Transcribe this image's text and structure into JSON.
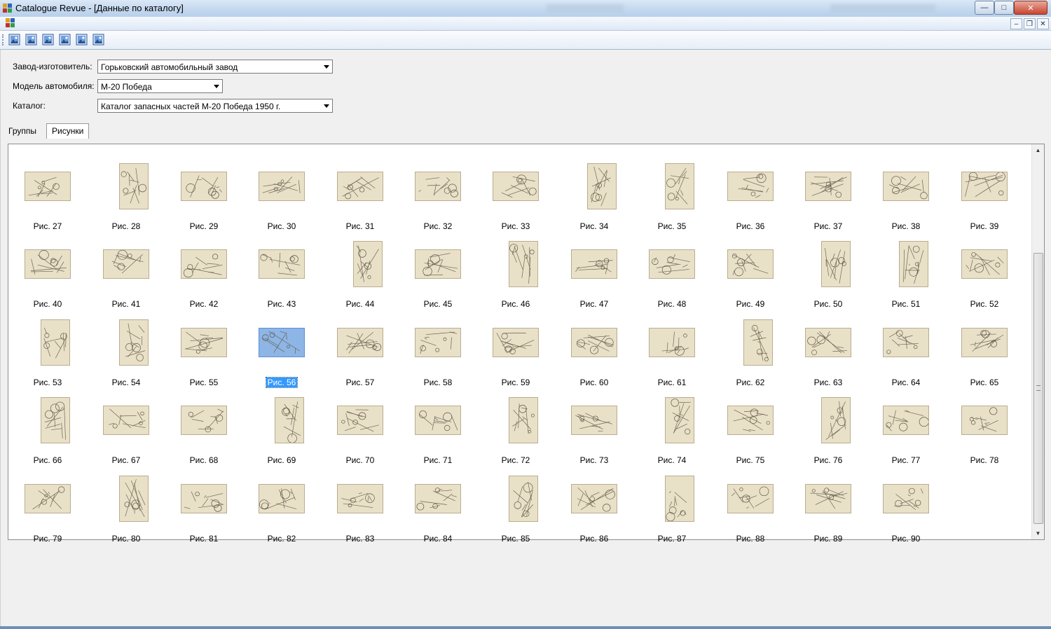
{
  "window": {
    "title": "Catalogue Revue - [Данные по каталогу]",
    "controls": {
      "minimize": "—",
      "maximize": "□",
      "close": "✕"
    },
    "mdi_controls": {
      "minimize": "–",
      "restore": "❐",
      "close": "✕"
    }
  },
  "toolbar": {
    "buttons": [
      "image-icon",
      "image-icon",
      "image-icon",
      "image-icon",
      "image-icon",
      "image-icon"
    ]
  },
  "form": {
    "manufacturer_label": "Завод-изготовитель:",
    "manufacturer_value": "Горьковский автомобильный завод",
    "model_label": "Модель автомобиля:",
    "model_value": "М-20 Победа",
    "catalog_label": "Каталог:",
    "catalog_value": "Каталог запасных частей М-20 Победа 1950 г."
  },
  "tabs": [
    {
      "label": "Группы",
      "active": false
    },
    {
      "label": "Рисунки",
      "active": true
    }
  ],
  "gallery": {
    "selected": "Рис. 56",
    "items": [
      "Рис. 27",
      "Рис. 28",
      "Рис. 29",
      "Рис. 30",
      "Рис. 31",
      "Рис. 32",
      "Рис. 33",
      "Рис. 34",
      "Рис. 35",
      "Рис. 36",
      "Рис. 37",
      "Рис. 38",
      "Рис. 39",
      "Рис. 40",
      "Рис. 41",
      "Рис. 42",
      "Рис. 43",
      "Рис. 44",
      "Рис. 45",
      "Рис. 46",
      "Рис. 47",
      "Рис. 48",
      "Рис. 49",
      "Рис. 50",
      "Рис. 51",
      "Рис. 52",
      "Рис. 53",
      "Рис. 54",
      "Рис. 55",
      "Рис. 56",
      "Рис. 57",
      "Рис. 58",
      "Рис. 59",
      "Рис. 60",
      "Рис. 61",
      "Рис. 62",
      "Рис. 63",
      "Рис. 64",
      "Рис. 65",
      "Рис. 66",
      "Рис. 67",
      "Рис. 68",
      "Рис. 69",
      "Рис. 70",
      "Рис. 71",
      "Рис. 72",
      "Рис. 73",
      "Рис. 74",
      "Рис. 75",
      "Рис. 76",
      "Рис. 77",
      "Рис. 78",
      "Рис. 79",
      "Рис. 80",
      "Рис. 81",
      "Рис. 82",
      "Рис. 83",
      "Рис. 84",
      "Рис. 85",
      "Рис. 86",
      "Рис. 87",
      "Рис. 88",
      "Рис. 89",
      "Рис. 90"
    ],
    "portrait": [
      "Рис. 28",
      "Рис. 34",
      "Рис. 35",
      "Рис. 44",
      "Рис. 46",
      "Рис. 50",
      "Рис. 51",
      "Рис. 53",
      "Рис. 54",
      "Рис. 62",
      "Рис. 66",
      "Рис. 69",
      "Рис. 72",
      "Рис. 74",
      "Рис. 76",
      "Рис. 80",
      "Рис. 85",
      "Рис. 87"
    ]
  },
  "colors": {
    "selection": "#3399ff",
    "thumb_paper": "#e9e0c8",
    "titlebar": "#c4d8ef"
  }
}
